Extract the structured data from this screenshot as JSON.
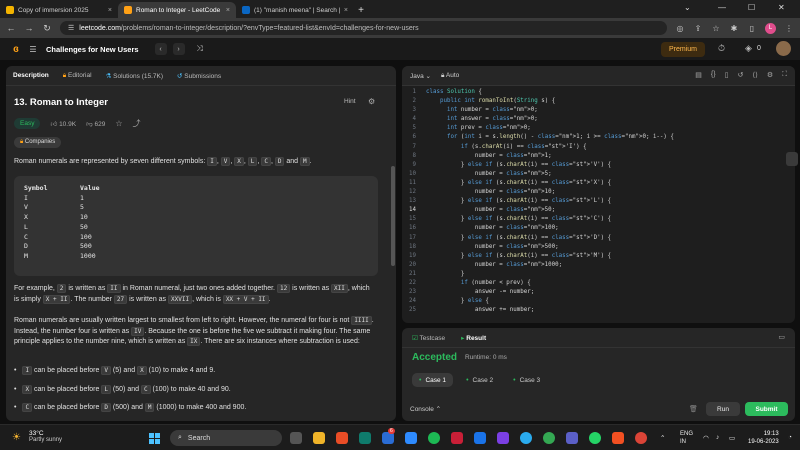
{
  "browser": {
    "tabs": [
      {
        "label": "Copy of immersion 2025",
        "color": "#f4b400"
      },
      {
        "label": "Roman to Integer - LeetCode",
        "color": "#ffa116"
      },
      {
        "label": "(1) \"manish meena\" | Search | Lin",
        "color": "#0a66c2"
      }
    ],
    "url_host": "leetcode.com",
    "url_path": "/problems/roman-to-integer/description/?envType=featured-list&envId=challenges-for-new-users",
    "avatar_letter": "L"
  },
  "leetcode": {
    "list_title": "Challenges for New Users",
    "premium": "Premium",
    "coins": "0"
  },
  "problem": {
    "tabs": [
      "Description",
      "Editorial",
      "Solutions (15.7K)",
      "Submissions"
    ],
    "title": "13. Roman to Integer",
    "hint": "Hint",
    "difficulty": "Easy",
    "likes": "10.9K",
    "dislikes": "629",
    "companies": "Companies",
    "intro_a": "Roman numerals are represented by seven different symbols: ",
    "symbols": [
      "I",
      "V",
      "X",
      "L",
      "C",
      "D",
      "M"
    ],
    "table_header": [
      "Symbol",
      "Value"
    ],
    "table": [
      [
        "I",
        "1"
      ],
      [
        "V",
        "5"
      ],
      [
        "X",
        "10"
      ],
      [
        "L",
        "50"
      ],
      [
        "C",
        "100"
      ],
      [
        "D",
        "500"
      ],
      [
        "M",
        "1000"
      ]
    ],
    "p2_a": "For example, ",
    "p2_c2": "2",
    "p2_b": " is written as ",
    "p2_c_ii": "II",
    "p2_c": " in Roman numeral, just two ones added together. ",
    "p2_c12": "12",
    "p2_d": " is written as ",
    "p2_cxii": "XII",
    "p2_e": ", which is simply ",
    "p2_cxpii": "X + II",
    "p2_f": ". The number ",
    "p2_c27": "27",
    "p2_g": " is written as ",
    "p2_cxxvii": "XXVII",
    "p2_h": ", which is ",
    "p2_cxx": "XX + V + II",
    "p3_a": "Roman numerals are usually written largest to smallest from left to right. However, the numeral for four is not ",
    "p3_ciiii": "IIII",
    "p3_b": ". Instead, the number four is written as ",
    "p3_civ": "IV",
    "p3_c": ". Because the one is before the five we subtract it making four. The same principle applies to the number nine, which is written as ",
    "p3_cix": "IX",
    "p3_d": ". There are six instances where subtraction is used:",
    "bullets": [
      {
        "c": "I",
        "a": " can be placed before ",
        "c1": "V",
        "b": " (5) and ",
        "c2": "X",
        "d": " (10) to make 4 and 9."
      },
      {
        "c": "X",
        "a": " can be placed before ",
        "c1": "L",
        "b": " (50) and ",
        "c2": "C",
        "d": " (100) to make 40 and 90."
      },
      {
        "c": "C",
        "a": " can be placed before ",
        "c1": "D",
        "b": " (500) and ",
        "c2": "M",
        "d": " (1000) to make 400 and 900."
      }
    ]
  },
  "editor": {
    "language": "Java",
    "auto": "Auto",
    "lines": [
      "class Solution {",
      "    public int romanToInt(String s) {",
      "      int number = 0;",
      "      int answer = 0;",
      "      int prev = 0;",
      "      for (int i = s.length() - 1; i >= 0; i--) {",
      "          if (s.charAt(i) == 'I') {",
      "              number = 1;",
      "          } else if (s.charAt(i) == 'V') {",
      "              number = 5;",
      "          } else if (s.charAt(i) == 'X') {",
      "              number = 10;",
      "          } else if (s.charAt(i) == 'L') {",
      "              number = 50;",
      "          } else if (s.charAt(i) == 'C') {",
      "              number = 100;",
      "          } else if (s.charAt(i) == 'D') {",
      "              number = 500;",
      "          } else if (s.charAt(i) == 'M') {",
      "              number = 1000;",
      "          }",
      "          if (number < prev) {",
      "              answer -= number;",
      "          } else {",
      "              answer += number;"
    ],
    "current_line": 14
  },
  "result": {
    "tabs": [
      "Testcase",
      "Result"
    ],
    "status": "Accepted",
    "runtime": "Runtime: 0 ms",
    "cases": [
      "Case 1",
      "Case 2",
      "Case 3"
    ],
    "console": "Console",
    "run": "Run",
    "submit": "Submit"
  },
  "taskbar": {
    "temp": "33°C",
    "weather": "Partly sunny",
    "search": "Search",
    "lang1": "ENG",
    "lang2": "IN",
    "time": "19:13",
    "date": "19-06-2023",
    "badge": "6"
  }
}
